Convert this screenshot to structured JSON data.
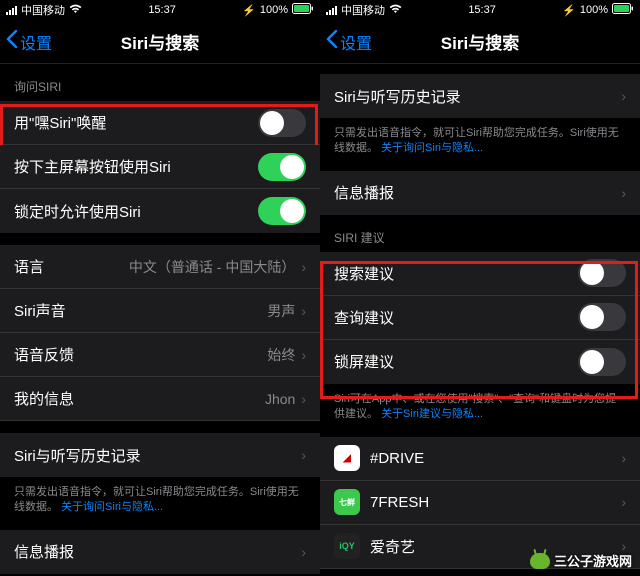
{
  "status": {
    "carrier": "中国移动",
    "time": "15:37",
    "battery": "100%"
  },
  "nav": {
    "back": "设置",
    "title": "Siri与搜索"
  },
  "left": {
    "section_ask": "询问SIRI",
    "hey_siri": "用\"嘿Siri\"唤醒",
    "home_btn": "按下主屏幕按钮使用Siri",
    "locked": "锁定时允许使用Siri",
    "language_label": "语言",
    "language_value": "中文（普通话 - 中国大陆）",
    "voice_label": "Siri声音",
    "voice_value": "男声",
    "feedback_label": "语音反馈",
    "feedback_value": "始终",
    "myinfo_label": "我的信息",
    "myinfo_value": "Jhon",
    "history": "Siri与听写历史记录",
    "footer1a": "只需发出语音指令，就可让Siri帮助您完成任务。Siri使用无线数据。",
    "footer1_link": "关于询问Siri与隐私...",
    "broadcast": "信息播报"
  },
  "right": {
    "history": "Siri与听写历史记录",
    "footer1a": "只需发出语音指令，就可让Siri帮助您完成任务。Siri使用无线数据。",
    "footer1_link": "关于询问Siri与隐私...",
    "broadcast": "信息播报",
    "section_suggest": "SIRI 建议",
    "search_sug": "搜索建议",
    "lookup_sug": "查询建议",
    "lock_sug": "锁屏建议",
    "footer2a": "Siri可在App中、或在您使用\"搜索\"、\"查询\"和键盘时为您提供建议。",
    "footer2_link": "关于Siri建议与隐私...",
    "app_drive": "#DRIVE",
    "app_7fresh": "7FRESH",
    "app_iqy": "爱奇艺"
  },
  "watermark": "三公子游戏网"
}
